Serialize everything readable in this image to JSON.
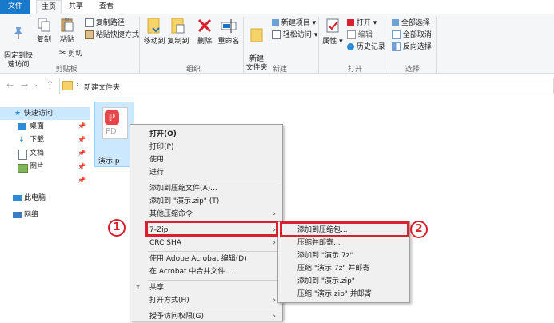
{
  "ribbon_tabs": {
    "file": "文件",
    "home": "主页",
    "share": "共享",
    "view": "查看"
  },
  "clipboard": {
    "pin": "固定到快\n速访问",
    "copy": "复制",
    "paste": "粘贴",
    "copy_path": "复制路径",
    "paste_shortcut": "粘贴快捷方式",
    "cut": "剪切",
    "label": "剪贴板"
  },
  "organize": {
    "move_to": "移动到",
    "copy_to": "复制到",
    "delete": "删除",
    "rename": "重命名",
    "label": "组织"
  },
  "new": {
    "new_folder": "新建\n文件夹",
    "new_item": "新建项目",
    "easy_access": "轻松访问",
    "label": "新建"
  },
  "open": {
    "properties": "属性",
    "open": "打开",
    "edit": "编辑",
    "history": "历史记录",
    "label": "打开"
  },
  "select": {
    "select_all": "全部选择",
    "select_none": "全部取消",
    "invert": "反向选择",
    "label": "选择"
  },
  "address": {
    "path": "新建文件夹"
  },
  "navpane": {
    "quick_access": "快速访问",
    "items": [
      "桌面",
      "下载",
      "文档",
      "图片"
    ],
    "this_pc": "此电脑",
    "network": "网络"
  },
  "file": {
    "name": "演示.p",
    "thumb_text": "PD"
  },
  "context_menu": {
    "items": [
      "打开(O)",
      "打印(P)",
      "使用",
      "进行",
      "添加到压缩文件(A)...",
      "添加到 \"演示.zip\" (T)",
      "其他压缩命令",
      "7-Zip",
      "CRC SHA",
      "使用 Adobe Acrobat 编辑(D)",
      "在 Acrobat 中合并文件...",
      "共享",
      "打开方式(H)",
      "授予访问权限(G)"
    ]
  },
  "submenu": {
    "items": [
      "添加到压缩包...",
      "压缩并邮寄...",
      "添加到 \"演示.7z\"",
      "压缩 \"演示.7z\" 并邮寄",
      "添加到 \"演示.zip\"",
      "压缩 \"演示.zip\" 并邮寄"
    ]
  },
  "annotations": {
    "one": "1",
    "two": "2"
  },
  "colors": {
    "accent": "#1979ca",
    "highlight_red": "#d8202f",
    "pdf_red": "#e8454a"
  }
}
